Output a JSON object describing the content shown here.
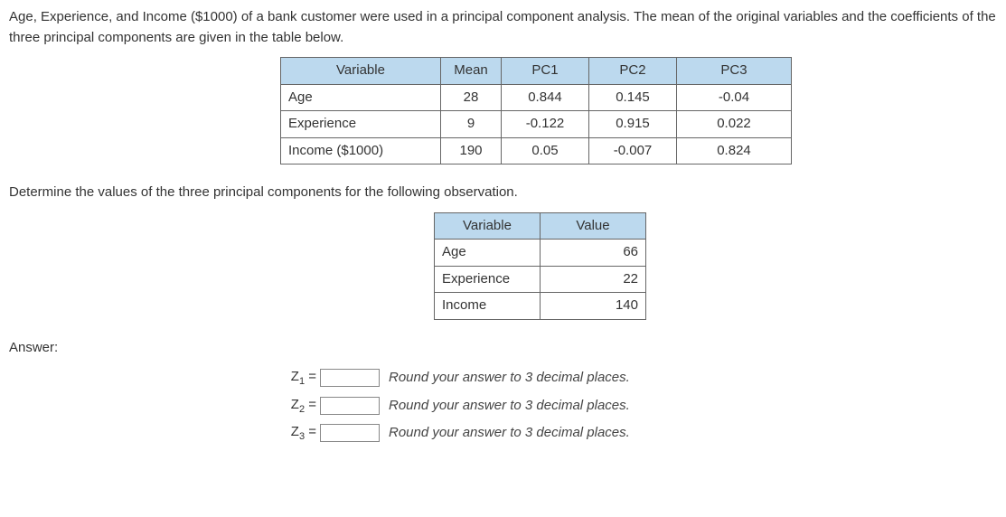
{
  "intro": "Age, Experience, and Income ($1000) of a bank customer were used in a principal component analysis.  The mean of the original variables and the coefficients of the three principal components are given in the table below.",
  "pca_table": {
    "headers": {
      "variable": "Variable",
      "mean": "Mean",
      "pc1": "PC1",
      "pc2": "PC2",
      "pc3": "PC3"
    },
    "rows": [
      {
        "variable": "Age",
        "mean": "28",
        "pc1": "0.844",
        "pc2": "0.145",
        "pc3": "-0.04"
      },
      {
        "variable": "Experience",
        "mean": "9",
        "pc1": "-0.122",
        "pc2": "0.915",
        "pc3": "0.022"
      },
      {
        "variable": "Income ($1000)",
        "mean": "190",
        "pc1": "0.05",
        "pc2": "-0.007",
        "pc3": "0.824"
      }
    ]
  },
  "prompt": "Determine the values of the three principal components for the following observation.",
  "obs_table": {
    "headers": {
      "variable": "Variable",
      "value": "Value"
    },
    "rows": [
      {
        "variable": "Age",
        "value": "66"
      },
      {
        "variable": "Experience",
        "value": "22"
      },
      {
        "variable": "Income",
        "value": "140"
      }
    ]
  },
  "answer_label": "Answer:",
  "answers": {
    "z1": {
      "label": "Z",
      "sub": "1",
      "eq": " = ",
      "hint": "Round your answer to 3 decimal places."
    },
    "z2": {
      "label": "Z",
      "sub": "2",
      "eq": " = ",
      "hint": "Round your answer to 3 decimal places."
    },
    "z3": {
      "label": "Z",
      "sub": "3",
      "eq": " = ",
      "hint": "Round your answer to 3 decimal places."
    }
  },
  "chart_data": {
    "type": "table",
    "pca": {
      "variables": [
        "Age",
        "Experience",
        "Income ($1000)"
      ],
      "mean": [
        28,
        9,
        190
      ],
      "PC1": [
        0.844,
        -0.122,
        0.05
      ],
      "PC2": [
        0.145,
        0.915,
        -0.007
      ],
      "PC3": [
        -0.04,
        0.022,
        0.824
      ]
    },
    "observation": {
      "Age": 66,
      "Experience": 22,
      "Income": 140
    }
  }
}
